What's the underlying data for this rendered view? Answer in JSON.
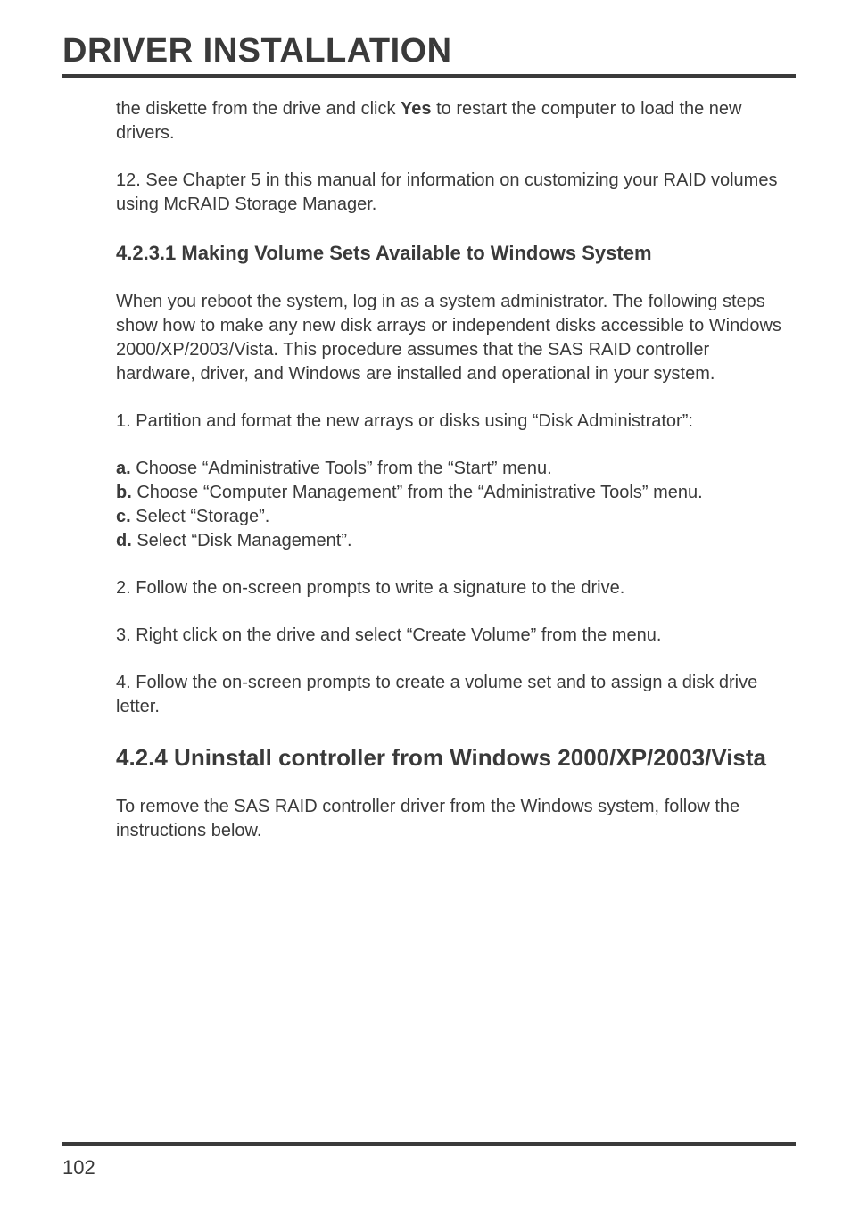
{
  "page_title": "DRIVER INSTALLATION",
  "para1_pre": "the diskette from the drive and click ",
  "para1_bold": "Yes",
  "para1_post": " to restart the computer to load the new drivers.",
  "para2": "12. See Chapter 5 in this manual for information on customizing your RAID volumes using McRAID Storage Manager.",
  "subheading1": "4.2.3.1 Making Volume Sets Available to Windows System",
  "para3": "When you reboot the system, log in as a system administrator. The following steps show how to make any new disk arrays or independent disks accessible to Windows 2000/XP/2003/Vista. This procedure assumes that the SAS RAID controller hardware, driver, and Windows are installed and operational in your system.",
  "para4": "1. Partition and format the new arrays or disks using “Disk Administrator”:",
  "list_a_label": "a.",
  "list_a_text": " Choose “Administrative Tools” from the “Start” menu.",
  "list_b_label": "b.",
  "list_b_text": " Choose “Computer Management” from the “Administrative Tools” menu.",
  "list_c_label": "c.",
  "list_c_text": " Select “Storage”.",
  "list_d_label": "d.",
  "list_d_text": " Select “Disk Management”.",
  "para5": "2. Follow the on-screen prompts to write a signature to the drive.",
  "para6": "3. Right click on the drive and select “Create Volume” from the menu.",
  "para7": "4. Follow the on-screen prompts to create a volume set and to assign a disk drive letter.",
  "section_heading": "4.2.4 Uninstall controller from Windows 2000/XP/2003/Vista",
  "para8": "To remove the SAS RAID controller driver from the Windows system, follow the instructions below.",
  "page_number": "102"
}
